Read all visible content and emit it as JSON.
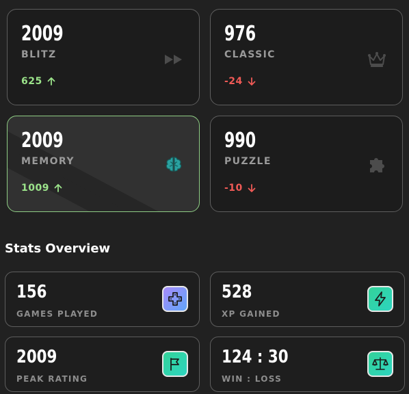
{
  "modes": [
    {
      "rating": "2009",
      "name": "BLITZ",
      "delta": "625",
      "direction": "up",
      "icon": "fast-forward-icon"
    },
    {
      "rating": "976",
      "name": "CLASSIC",
      "delta": "-24",
      "direction": "down",
      "icon": "crown-icon"
    },
    {
      "rating": "2009",
      "name": "MEMORY",
      "delta": "1009",
      "direction": "up",
      "icon": "brain-icon",
      "selected": true
    },
    {
      "rating": "990",
      "name": "PUZZLE",
      "delta": "-10",
      "direction": "down",
      "icon": "puzzle-icon"
    }
  ],
  "stats_title": "Stats Overview",
  "stats": [
    {
      "value": "156",
      "label": "GAMES PLAYED",
      "icon": "gamepad-icon"
    },
    {
      "value": "528",
      "label": "XP GAINED",
      "icon": "lightning-icon"
    },
    {
      "value": "2009",
      "label": "PEAK RATING",
      "icon": "flag-icon"
    },
    {
      "value": "124 : 30",
      "label": "WIN : LOSS",
      "icon": "scale-icon"
    }
  ],
  "colors": {
    "background": "#212121",
    "up": "#9be38a",
    "down": "#f05a56",
    "selected_border": "#8fce85"
  }
}
